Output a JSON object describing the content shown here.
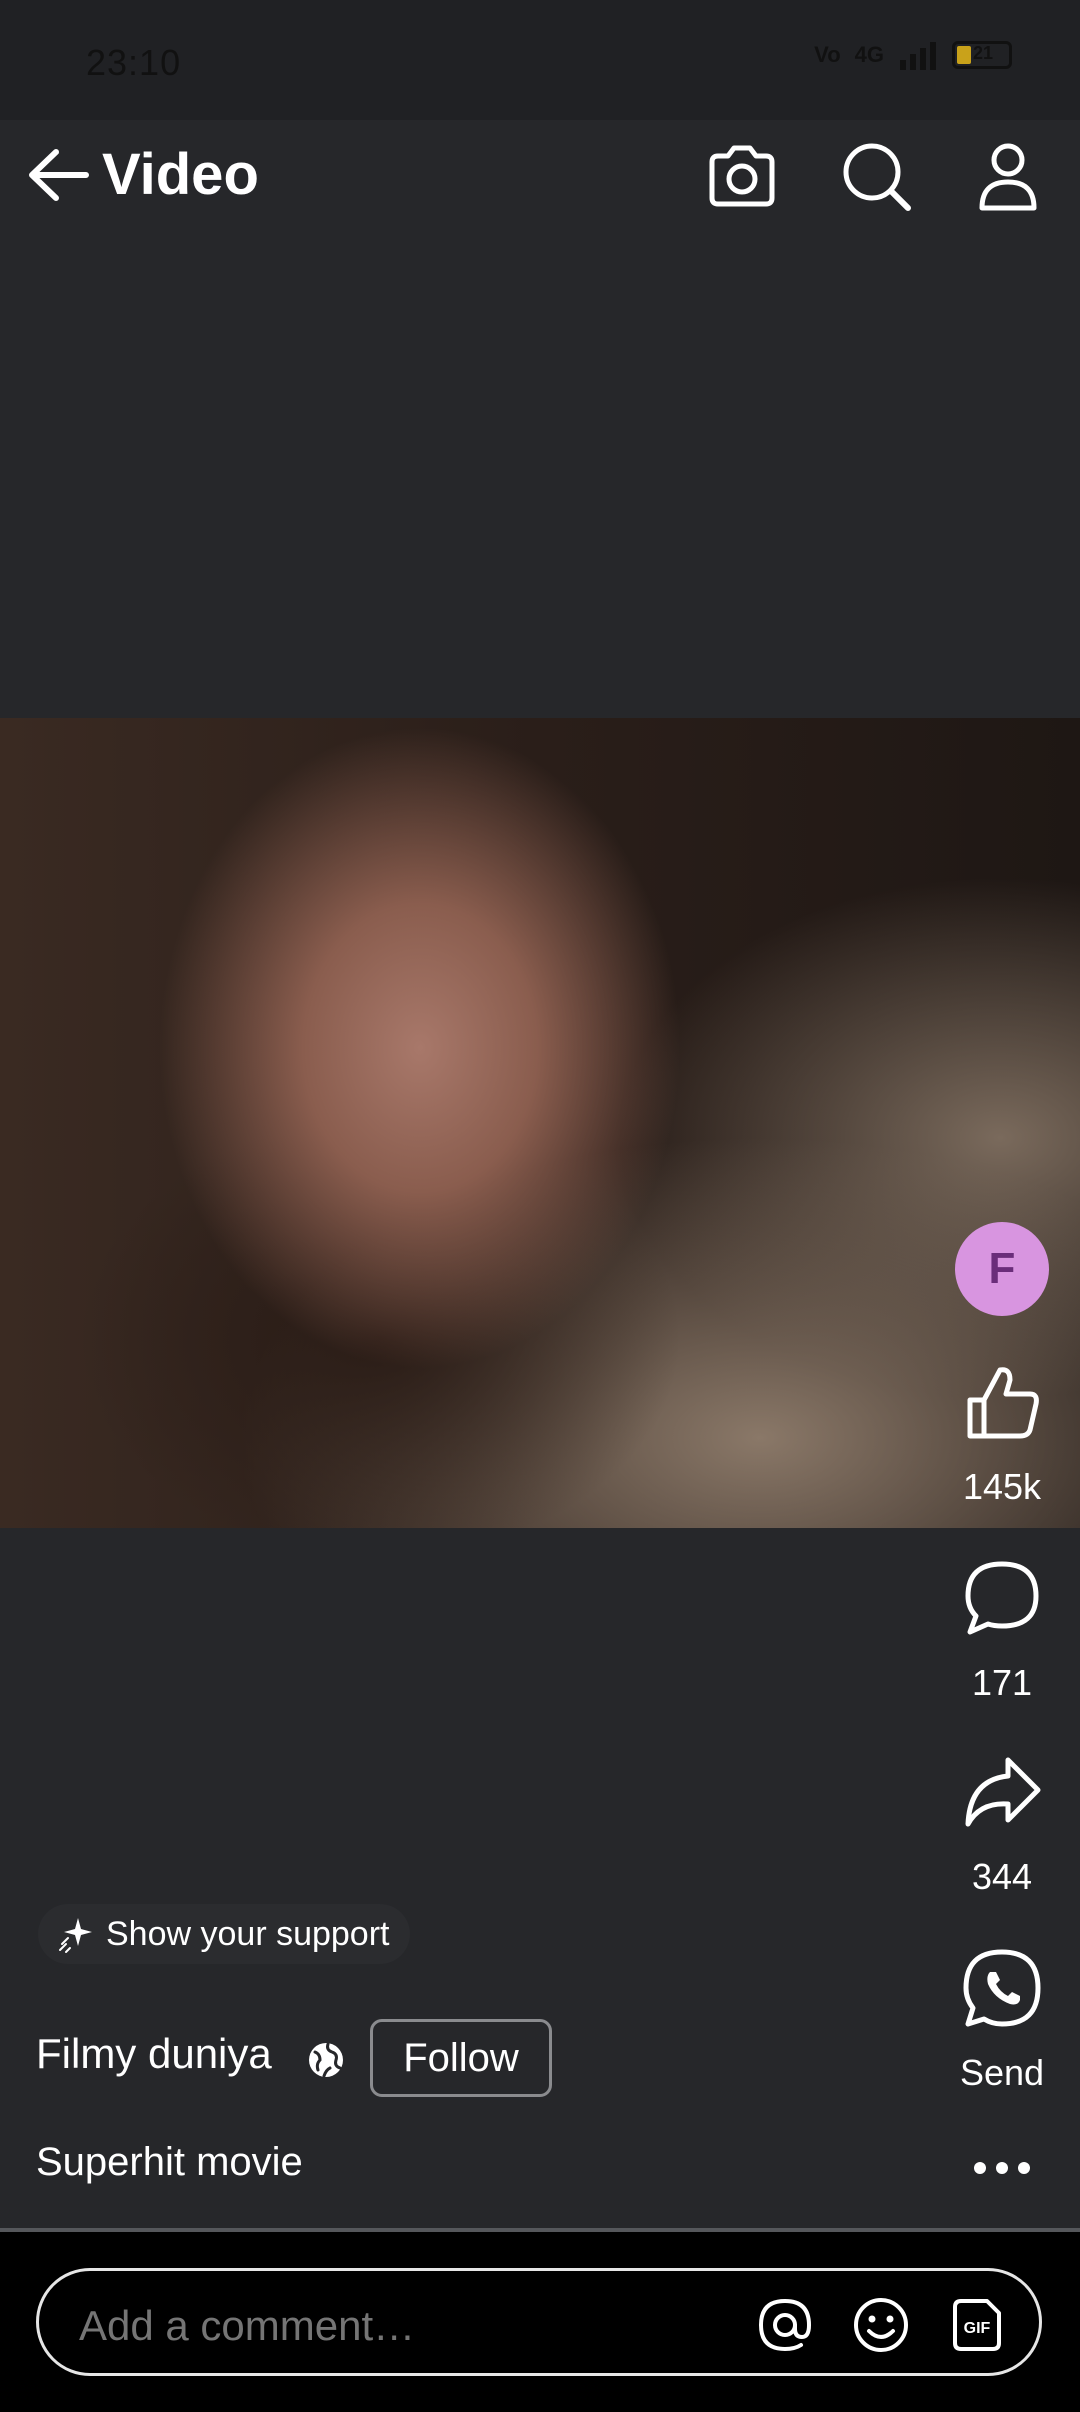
{
  "status_bar": {
    "time": "23:10",
    "network": "4G",
    "battery": "21"
  },
  "header": {
    "title": "Video",
    "icons": [
      "back-arrow-icon",
      "camera-icon",
      "search-icon",
      "profile-icon"
    ]
  },
  "rail": {
    "avatar_letter": "F",
    "like_count": "145k",
    "comment_count": "171",
    "share_count": "344",
    "send_label": "Send"
  },
  "post": {
    "support_label": "Show your support",
    "author": "Filmy duniya",
    "follow_label": "Follow",
    "caption": "Superhit movie"
  },
  "comment": {
    "placeholder": "Add a comment…"
  },
  "colors": {
    "background": "#26272a",
    "avatar_bg": "#d895e0",
    "avatar_text": "#6a2d7a",
    "comment_bar": "#000000"
  }
}
